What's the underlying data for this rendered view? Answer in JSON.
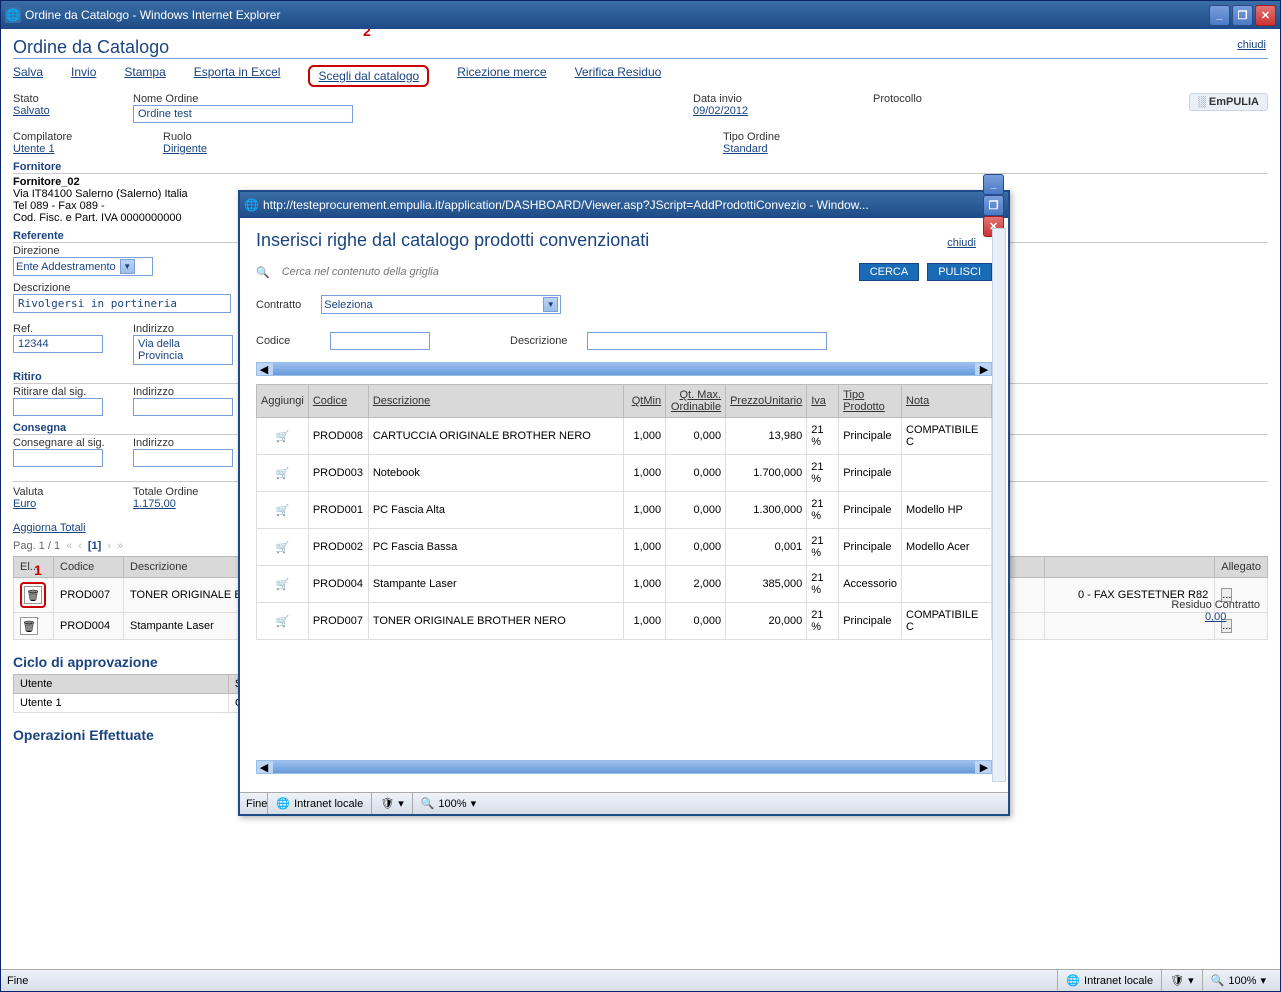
{
  "main_titlebar": "Ordine da Catalogo - Windows Internet Explorer",
  "page_title": "Ordine da Catalogo",
  "chiudi": "chiudi",
  "toolbar": {
    "salva": "Salva",
    "invio": "Invio",
    "stampa": "Stampa",
    "esporta": "Esporta in Excel",
    "scegli": "Scegli dal catalogo",
    "ricezione": "Ricezione merce",
    "verifica": "Verifica Residuo"
  },
  "annotations": {
    "num1": "1",
    "num2": "2"
  },
  "header": {
    "stato_label": "Stato",
    "stato_value": "Salvato",
    "nome_ordine_label": "Nome Ordine",
    "nome_ordine_value": "Ordine test",
    "data_invio_label": "Data invio",
    "data_invio_value": "09/02/2012",
    "protocollo_label": "Protocollo",
    "logo": "EmPULIA",
    "compilatore_label": "Compilatore",
    "compilatore_value": "Utente 1",
    "ruolo_label": "Ruolo",
    "ruolo_value": "Dirigente",
    "tipo_ordine_label": "Tipo Ordine",
    "tipo_ordine_value": "Standard"
  },
  "fornitore": {
    "section": "Fornitore",
    "name": "Fornitore_02",
    "addr": "Via IT84100 Salerno (Salerno) Italia",
    "tel": "Tel 089 - Fax 089 -",
    "cod": "Cod. Fisc. e Part. IVA 0000000000"
  },
  "referente": {
    "section": "Referente",
    "direzione_label": "Direzione",
    "direzione_value": "Ente Addestramento",
    "descrizione_label": "Descrizione",
    "descrizione_value": "Rivolgersi in portineria",
    "ref_label": "Ref.",
    "ref_value": "12344",
    "indirizzo_label": "Indirizzo",
    "indirizzo_value": "Via della Provincia"
  },
  "ritiro": {
    "section": "Ritiro",
    "ritirare_label": "Ritirare dal sig.",
    "indirizzo_label": "Indirizzo"
  },
  "consegna": {
    "section": "Consegna",
    "consegnare_label": "Consegnare al sig.",
    "indirizzo_label": "Indirizzo"
  },
  "totali": {
    "valuta_label": "Valuta",
    "valuta_value": "Euro",
    "totale_label": "Totale Ordine",
    "totale_value": "1.175,00",
    "residuo_label": "Residuo Contratto",
    "residuo_value": "0,00",
    "aggiorna": "Aggiorna Totali"
  },
  "pager": {
    "text": "Pag. 1 / 1",
    "current": "[1]"
  },
  "order_table": {
    "headers": {
      "el": "El...",
      "codice": "Codice",
      "descrizione": "Descrizione",
      "allegato": "Allegato"
    },
    "rows": [
      {
        "codice": "PROD007",
        "descrizione": "TONER ORIGINALE BR",
        "extra": "0 - FAX GESTETNER R82"
      },
      {
        "codice": "PROD004",
        "descrizione": "Stampante Laser",
        "extra": ""
      }
    ]
  },
  "ciclo": {
    "title": "Ciclo di approvazione",
    "headers": {
      "utente": "Utente",
      "stato": "Stato"
    },
    "row": {
      "utente": "Utente 1",
      "stato": "Compiled"
    }
  },
  "operazioni": "Operazioni Effettuate",
  "statusbar": {
    "fine": "Fine",
    "intranet": "Intranet locale",
    "zoom": "100%"
  },
  "popup": {
    "titlebar": "http://testeprocurement.empulia.it/application/DASHBOARD/Viewer.asp?JScript=AddProdottiConvezio - Window...",
    "title": "Inserisci righe dal catalogo prodotti convenzionati",
    "chiudi": "chiudi",
    "search_placeholder": "Cerca nel contenuto della griglia",
    "cerca": "CERCA",
    "pulisci": "PULISCI",
    "contratto_label": "Contratto",
    "contratto_value": "Seleziona",
    "codice_label": "Codice",
    "descrizione_label": "Descrizione",
    "table": {
      "headers": {
        "aggiungi": "Aggiungi",
        "codice": "Codice",
        "descrizione": "Descrizione",
        "qtmin": "QtMin",
        "qtmax": "Qt. Max. Ordinabile",
        "prezzo": "PrezzoUnitario",
        "iva": "Iva",
        "tipo": "Tipo Prodotto",
        "nota": "Nota"
      },
      "rows": [
        {
          "codice": "PROD008",
          "descrizione": "CARTUCCIA ORIGINALE BROTHER NERO",
          "qtmin": "1,000",
          "qtmax": "0,000",
          "prezzo": "13,980",
          "iva": "21 %",
          "tipo": "Principale",
          "nota": "COMPATIBILE C"
        },
        {
          "codice": "PROD003",
          "descrizione": "Notebook",
          "qtmin": "1,000",
          "qtmax": "0,000",
          "prezzo": "1.700,000",
          "iva": "21 %",
          "tipo": "Principale",
          "nota": ""
        },
        {
          "codice": "PROD001",
          "descrizione": "PC Fascia Alta",
          "qtmin": "1,000",
          "qtmax": "0,000",
          "prezzo": "1.300,000",
          "iva": "21 %",
          "tipo": "Principale",
          "nota": "Modello HP"
        },
        {
          "codice": "PROD002",
          "descrizione": "PC Fascia Bassa",
          "qtmin": "1,000",
          "qtmax": "0,000",
          "prezzo": "0,001",
          "iva": "21 %",
          "tipo": "Principale",
          "nota": "Modello Acer"
        },
        {
          "codice": "PROD004",
          "descrizione": "Stampante Laser",
          "qtmin": "1,000",
          "qtmax": "2,000",
          "prezzo": "385,000",
          "iva": "21 %",
          "tipo": "Accessorio",
          "nota": ""
        },
        {
          "codice": "PROD007",
          "descrizione": "TONER ORIGINALE BROTHER NERO",
          "qtmin": "1,000",
          "qtmax": "0,000",
          "prezzo": "20,000",
          "iva": "21 %",
          "tipo": "Principale",
          "nota": "COMPATIBILE C"
        }
      ]
    },
    "status_fine": "Fine",
    "status_intranet": "Intranet locale",
    "status_zoom": "100%"
  }
}
